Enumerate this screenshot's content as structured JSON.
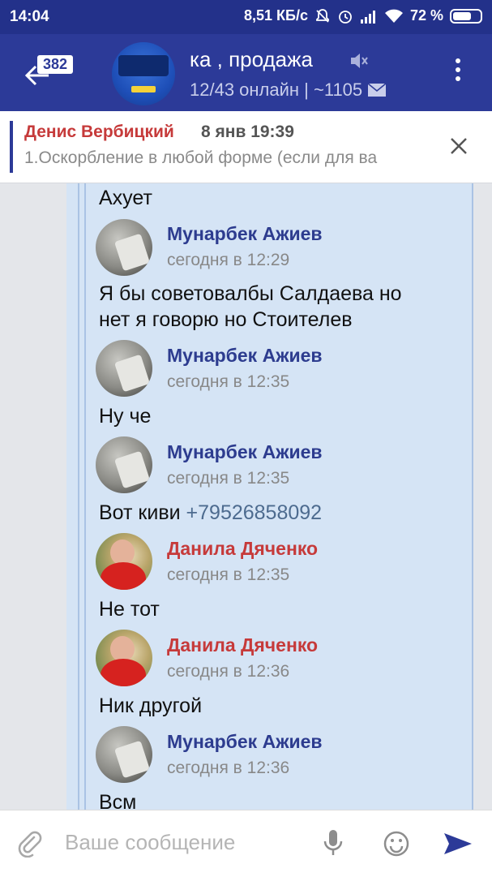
{
  "status": {
    "time": "14:04",
    "speed": "8,51 КБ/с",
    "battery": "72 %",
    "battery_level": 0.72
  },
  "header": {
    "unread": "382",
    "title": "ка , продажа",
    "subtitle": "12/43 онлайн | ~1105"
  },
  "pinned": {
    "author": "Денис Вербицкий",
    "date": "8 янв 19:39",
    "text": "1.Оскорбление в любой форме (если для ва"
  },
  "messages": [
    {
      "text": "Ахует"
    },
    {
      "name": "Мунарбек Ажиев",
      "time": "сегодня в 12:29",
      "text1": "Я бы советовалбы Салдаева но",
      "text2": "нет я говорю но Стоителев"
    },
    {
      "name": "Мунарбек Ажиев",
      "time": "сегодня в 12:35",
      "text": "Ну че"
    },
    {
      "name": "Мунарбек Ажиев",
      "time": "сегодня в 12:35",
      "text": "Вот киви ",
      "phone": "+79526858092"
    },
    {
      "name": "Данила Дяченко",
      "time": "сегодня в 12:35",
      "text": "Не тот"
    },
    {
      "name": "Данила Дяченко",
      "time": "сегодня в 12:36",
      "text": "Ник другой"
    },
    {
      "name": "Мунарбек Ажиев",
      "time": "сегодня в 12:36",
      "text": "Всм"
    }
  ],
  "input": {
    "placeholder": "Ваше сообщение"
  },
  "colors": {
    "appbar": "#2c3a98",
    "statusbar": "#23318a",
    "quote_bg": "#d5e4f5",
    "name_blue": "#2d3c8f",
    "name_red": "#c63a3a"
  }
}
